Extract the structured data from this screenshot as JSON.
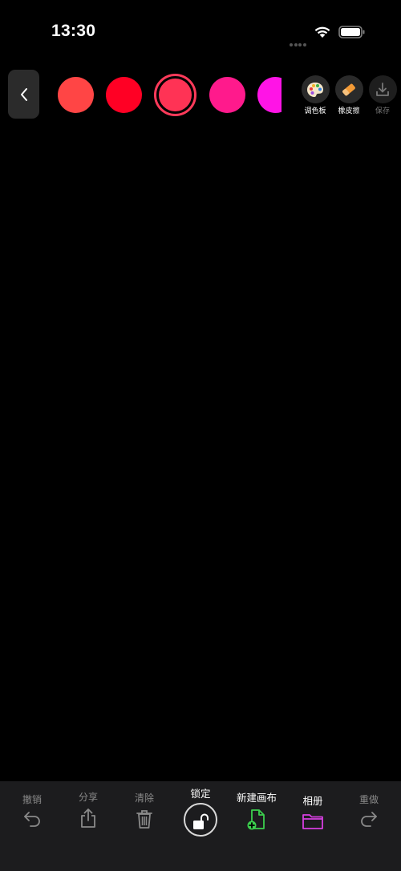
{
  "status_bar": {
    "time": "13:30"
  },
  "palette": {
    "swatches": [
      {
        "color": "#ff4545"
      },
      {
        "color": "#ff0024"
      },
      {
        "color": "#ff3355",
        "selected": true
      },
      {
        "color": "#ff1a8c"
      },
      {
        "color": "#ff14e6"
      }
    ]
  },
  "tools": {
    "palette_label": "调色板",
    "eraser_label": "橡皮擦",
    "save_label": "保存"
  },
  "bottom_bar": {
    "undo_label": "撤销",
    "share_label": "分享",
    "clear_label": "清除",
    "lock_label": "锁定",
    "new_canvas_label": "新建画布",
    "album_label": "相册",
    "redo_label": "重做"
  },
  "colors": {
    "new_canvas_icon": "#3ccf4e",
    "album_icon": "#d63fe0",
    "eraser_icon": "#f39a36"
  }
}
